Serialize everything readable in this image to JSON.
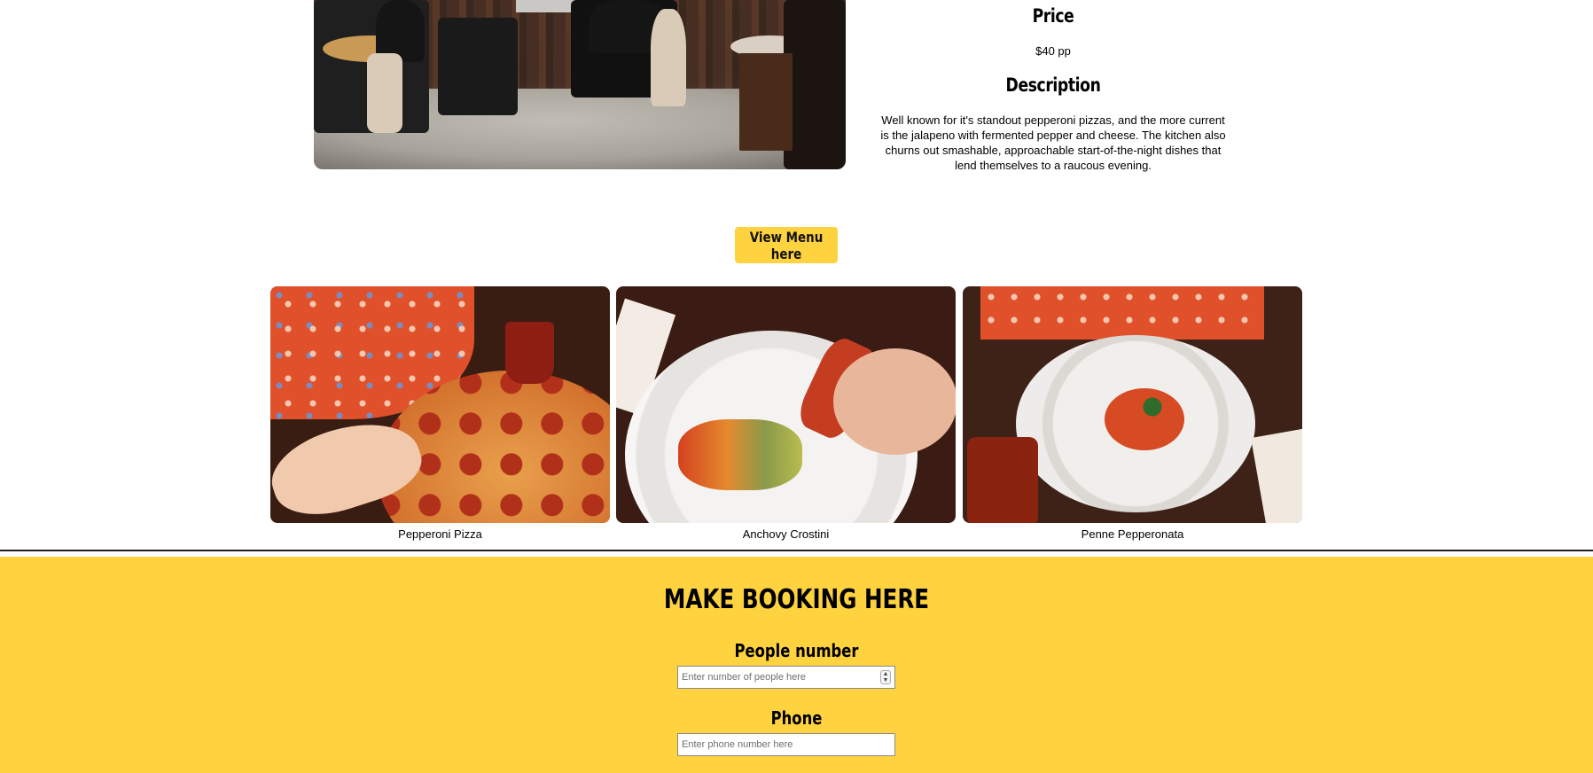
{
  "info": {
    "price_heading": "Price",
    "price_value": "$40 pp",
    "description_heading": "Description",
    "description_text": "Well known for it's standout pepperoni pizzas, and the more current is the jalapeno with fermented pepper and cheese. The kitchen also churns out smashable, approachable start-of-the-night dishes that lend themselves to a raucous evening."
  },
  "menu_button_label": "View Menu here",
  "dishes": [
    {
      "caption": "Pepperoni Pizza"
    },
    {
      "caption": "Anchovy Crostini"
    },
    {
      "caption": "Penne Pepperonata"
    }
  ],
  "booking": {
    "title": "MAKE BOOKING HERE",
    "people_label": "People number",
    "people_placeholder": "Enter number of people here",
    "phone_label": "Phone",
    "phone_placeholder": "Enter phone number here"
  },
  "colors": {
    "accent_yellow": "#ffd23f",
    "divider": "#222222"
  }
}
